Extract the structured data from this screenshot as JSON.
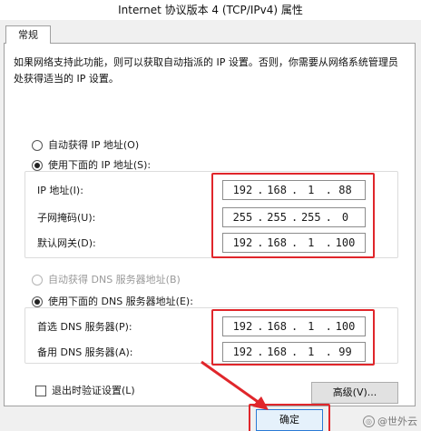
{
  "window": {
    "title": "Internet 协议版本 4 (TCP/IPv4) 属性"
  },
  "tabs": [
    {
      "label": "常规"
    }
  ],
  "description": "如果网络支持此功能，则可以获取自动指派的 IP 设置。否则，你需要从网络系统管理员处获得适当的 IP 设置。",
  "ip_section": {
    "auto_label": "自动获得 IP 地址(O)",
    "auto_selected": false,
    "manual_label": "使用下面的 IP 地址(S):",
    "manual_selected": true,
    "fields": {
      "ip": {
        "label": "IP 地址(I):",
        "octets": [
          "192",
          "168",
          "1",
          "88"
        ]
      },
      "mask": {
        "label": "子网掩码(U):",
        "octets": [
          "255",
          "255",
          "255",
          "0"
        ]
      },
      "gateway": {
        "label": "默认网关(D):",
        "octets": [
          "192",
          "168",
          "1",
          "100"
        ]
      }
    }
  },
  "dns_section": {
    "auto_label": "自动获得 DNS 服务器地址(B)",
    "auto_selected": false,
    "manual_label": "使用下面的 DNS 服务器地址(E):",
    "manual_selected": true,
    "fields": {
      "preferred": {
        "label": "首选 DNS 服务器(P):",
        "octets": [
          "192",
          "168",
          "1",
          "100"
        ]
      },
      "alternate": {
        "label": "备用 DNS 服务器(A):",
        "octets": [
          "192",
          "168",
          "1",
          "99"
        ]
      }
    }
  },
  "validate_on_exit": {
    "label": "退出时验证设置(L)",
    "checked": false
  },
  "buttons": {
    "advanced": "高级(V)...",
    "ok": "确定"
  },
  "watermark": "@世外云",
  "colors": {
    "highlight": "#e0262b",
    "panel": "#ffffff",
    "dialog": "#f0f0f0"
  }
}
